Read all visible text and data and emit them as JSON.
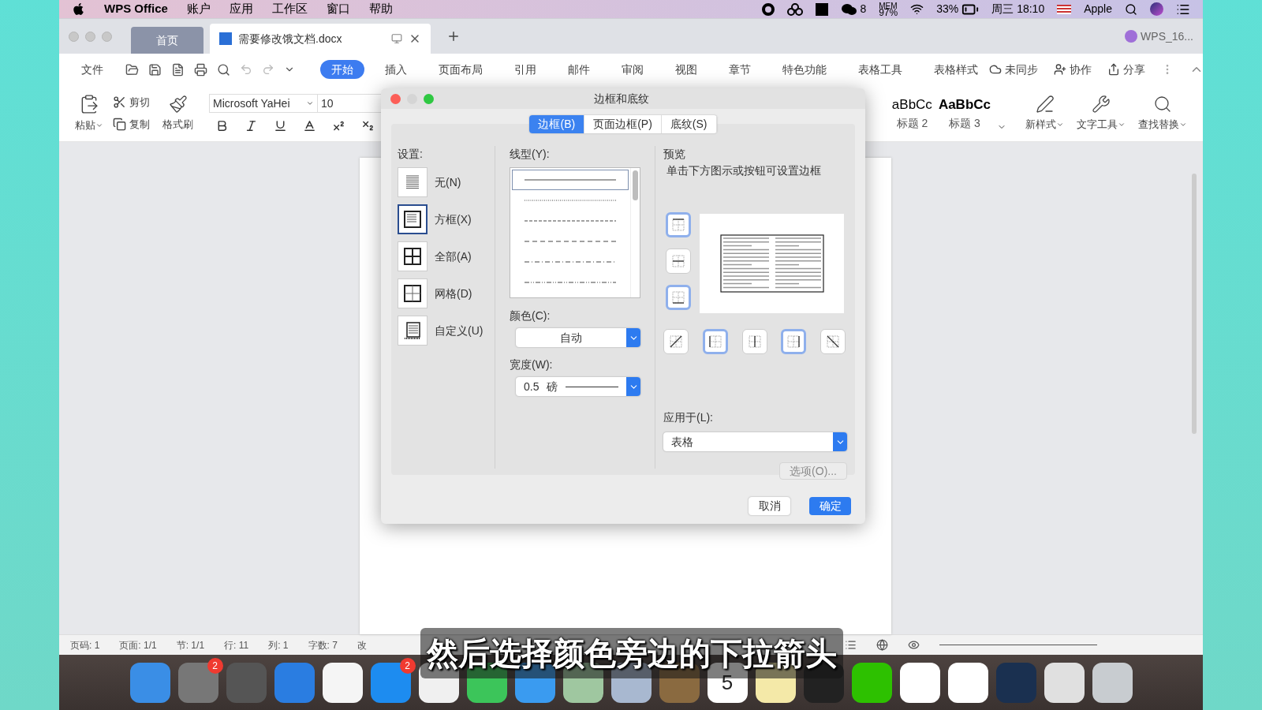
{
  "menubar": {
    "app": "WPS Office",
    "items": [
      "账户",
      "应用",
      "工作区",
      "窗口",
      "帮助"
    ],
    "wechat_count": "8",
    "mem_label": "MEM",
    "mem_value": "97%",
    "battery": "33%",
    "clock": "周三 18:10",
    "user": "Apple"
  },
  "tabs": [
    {
      "kind": "home",
      "label": "首页",
      "selected": false
    },
    {
      "kind": "doc",
      "label": "需要修改饿文档.docx",
      "selected": true
    }
  ],
  "account": "WPS_16...",
  "ribbon": {
    "file": "文件",
    "tabs": [
      {
        "label": "开始",
        "selected": true
      },
      {
        "label": "插入",
        "selected": false
      },
      {
        "label": "页面布局",
        "selected": false
      },
      {
        "label": "引用",
        "selected": false
      },
      {
        "label": "邮件",
        "selected": false
      },
      {
        "label": "审阅",
        "selected": false
      },
      {
        "label": "视图",
        "selected": false
      },
      {
        "label": "章节",
        "selected": false
      },
      {
        "label": "特色功能",
        "selected": false
      },
      {
        "label": "表格工具",
        "selected": false
      },
      {
        "label": "表格样式",
        "selected": false
      }
    ],
    "actions": [
      {
        "kind": "sync",
        "label": "未同步"
      },
      {
        "kind": "collab",
        "label": "协作"
      },
      {
        "kind": "share",
        "label": "分享"
      }
    ]
  },
  "toolbar": {
    "paste": "粘贴",
    "cut": "剪切",
    "copy": "复制",
    "painter": "格式刷",
    "font": "Microsoft YaHei",
    "size": "10",
    "styles": [
      {
        "sample": "aBbCc",
        "name": "标题 2"
      },
      {
        "sample": "AaBbCc",
        "name": "标题 3"
      }
    ],
    "tools": [
      {
        "kind": "newstyle",
        "label": "新样式"
      },
      {
        "kind": "texttools",
        "label": "文字工具"
      },
      {
        "kind": "find",
        "label": "查找替换"
      }
    ]
  },
  "dialog": {
    "title": "边框和底纹",
    "tabs": [
      {
        "label": "边框(B)",
        "selected": true
      },
      {
        "label": "页面边框(P)",
        "selected": false
      },
      {
        "label": "底纹(S)",
        "selected": false
      }
    ],
    "settings_label": "设置:",
    "settings": [
      {
        "kind": "none",
        "label": "无(N)",
        "selected": false
      },
      {
        "kind": "box",
        "label": "方框(X)",
        "selected": true
      },
      {
        "kind": "all",
        "label": "全部(A)",
        "selected": false
      },
      {
        "kind": "grid",
        "label": "网格(D)",
        "selected": false
      },
      {
        "kind": "custom",
        "label": "自定义(U)",
        "selected": false
      }
    ],
    "line_label": "线型(Y):",
    "line_styles": [
      {
        "kind": "solid",
        "selected": true
      },
      {
        "kind": "dotted",
        "selected": false
      },
      {
        "kind": "dashed",
        "selected": false
      },
      {
        "kind": "longdash",
        "selected": false
      },
      {
        "kind": "dashdot",
        "selected": false
      },
      {
        "kind": "dashdotdot",
        "selected": false
      }
    ],
    "color_label": "颜色(C):",
    "color_value": "自动",
    "width_label": "宽度(W):",
    "width_value": "0.5",
    "width_unit": "磅",
    "preview_label": "预览",
    "preview_hint": "单击下方图示或按钮可设置边框",
    "side_buttons": [
      {
        "kind": "top",
        "on": true
      },
      {
        "kind": "middle",
        "on": false
      },
      {
        "kind": "bottom",
        "on": true
      }
    ],
    "bottom_buttons": [
      {
        "kind": "diag_up",
        "on": false
      },
      {
        "kind": "left",
        "on": true
      },
      {
        "kind": "center",
        "on": false
      },
      {
        "kind": "right",
        "on": true
      },
      {
        "kind": "diag_down",
        "on": false
      }
    ],
    "apply_label": "应用于(L):",
    "apply_value": "表格",
    "options": {
      "label": "选项(O)...",
      "disabled": true
    },
    "cancel": "取消",
    "ok": "确定"
  },
  "status_bar": [
    "页码: 1",
    "页面: 1/1",
    "节: 1/1",
    "行: 11",
    "列: 1",
    "字数: 7",
    "改"
  ],
  "dock": [
    {
      "kind": "finder"
    },
    {
      "kind": "settings",
      "badge": "2"
    },
    {
      "kind": "launchpad"
    },
    {
      "kind": "safari"
    },
    {
      "kind": "photos"
    },
    {
      "kind": "appstore",
      "badge": "2"
    },
    {
      "kind": "music"
    },
    {
      "kind": "facetime"
    },
    {
      "kind": "messages"
    },
    {
      "kind": "maps"
    },
    {
      "kind": "preview"
    },
    {
      "kind": "notes_book"
    },
    {
      "kind": "calendar",
      "label": "5"
    },
    {
      "kind": "notes"
    },
    {
      "kind": "penguin"
    },
    {
      "kind": "wechat"
    },
    {
      "kind": "wps"
    },
    {
      "kind": "cloud"
    },
    {
      "kind": "quicktime"
    },
    {
      "kind": "screen"
    },
    {
      "kind": "trash"
    }
  ],
  "subtitle": "然后选择颜色旁边的下拉箭头"
}
